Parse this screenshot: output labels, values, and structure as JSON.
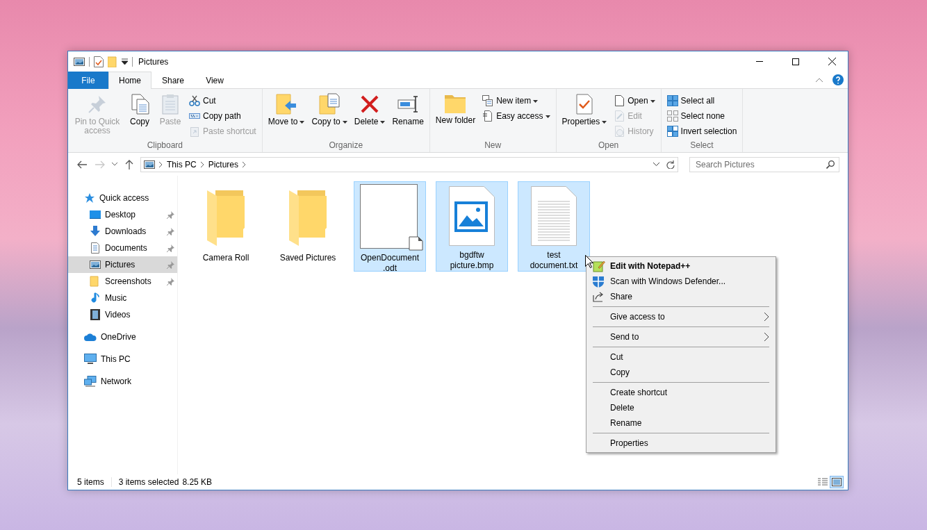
{
  "window": {
    "title": "Pictures"
  },
  "ribbon": {
    "tabs": [
      {
        "label": "File",
        "kind": "file",
        "selected": false
      },
      {
        "label": "Home",
        "kind": "tab",
        "selected": true
      },
      {
        "label": "Share",
        "kind": "tab",
        "selected": false
      },
      {
        "label": "View",
        "kind": "tab",
        "selected": false
      }
    ],
    "groups": [
      {
        "label": "Clipboard",
        "items": [
          {
            "kind": "large",
            "label": "Pin to Quick access",
            "disabled": true,
            "dropdown": false
          },
          {
            "kind": "large",
            "label": "Copy",
            "disabled": false,
            "dropdown": false
          },
          {
            "kind": "large",
            "label": "Paste",
            "disabled": true,
            "dropdown": false
          },
          {
            "kind": "stack",
            "items": [
              {
                "label": "Cut",
                "disabled": false,
                "dropdown": false
              },
              {
                "label": "Copy path",
                "disabled": false,
                "dropdown": false
              },
              {
                "label": "Paste shortcut",
                "disabled": true,
                "dropdown": false
              }
            ]
          }
        ]
      },
      {
        "label": "Organize",
        "items": [
          {
            "kind": "large",
            "label": "Move to",
            "disabled": false,
            "dropdown": true
          },
          {
            "kind": "large",
            "label": "Copy to",
            "disabled": false,
            "dropdown": true
          },
          {
            "kind": "large",
            "label": "Delete",
            "disabled": false,
            "dropdown": true
          },
          {
            "kind": "large",
            "label": "Rename",
            "disabled": false,
            "dropdown": false
          }
        ]
      },
      {
        "label": "New",
        "items": [
          {
            "kind": "large",
            "label": "New folder",
            "disabled": false,
            "dropdown": false
          },
          {
            "kind": "stack",
            "items": [
              {
                "label": "New item",
                "disabled": false,
                "dropdown": true
              },
              {
                "label": "Easy access",
                "disabled": false,
                "dropdown": true
              }
            ]
          }
        ]
      },
      {
        "label": "Open",
        "items": [
          {
            "kind": "large",
            "label": "Properties",
            "disabled": false,
            "dropdown": true
          },
          {
            "kind": "stack",
            "items": [
              {
                "label": "Open",
                "disabled": false,
                "dropdown": true
              },
              {
                "label": "Edit",
                "disabled": true,
                "dropdown": false
              },
              {
                "label": "History",
                "disabled": true,
                "dropdown": false
              }
            ]
          }
        ]
      },
      {
        "label": "Select",
        "items": [
          {
            "kind": "stack",
            "items": [
              {
                "label": "Select all",
                "disabled": false,
                "dropdown": false
              },
              {
                "label": "Select none",
                "disabled": false,
                "dropdown": false
              },
              {
                "label": "Invert selection",
                "disabled": false,
                "dropdown": false
              }
            ]
          }
        ]
      }
    ]
  },
  "address_bar": {
    "back_disabled": false,
    "forward_disabled": true,
    "breadcrumb": [
      "This PC",
      "Pictures"
    ]
  },
  "search": {
    "placeholder": "Search Pictures"
  },
  "navigation": [
    {
      "label": "Quick access",
      "selected": false,
      "pinned": false,
      "children": [
        {
          "label": "Desktop",
          "selected": false,
          "pinned": true
        },
        {
          "label": "Downloads",
          "selected": false,
          "pinned": true
        },
        {
          "label": "Documents",
          "selected": false,
          "pinned": true
        },
        {
          "label": "Pictures",
          "selected": true,
          "pinned": true
        },
        {
          "label": "Screenshots",
          "selected": false,
          "pinned": true
        },
        {
          "label": "Music",
          "selected": false,
          "pinned": false
        },
        {
          "label": "Videos",
          "selected": false,
          "pinned": false
        }
      ]
    },
    {
      "label": "OneDrive",
      "selected": false,
      "pinned": false
    },
    {
      "label": "This PC",
      "selected": false,
      "pinned": false
    },
    {
      "label": "Network",
      "selected": false,
      "pinned": false
    }
  ],
  "files": [
    {
      "name": "Camera Roll",
      "kind": "folder",
      "selected": false
    },
    {
      "name": "Saved Pictures",
      "kind": "folder",
      "selected": false
    },
    {
      "name": "OpenDocument.odt",
      "kind": "document",
      "selected": true
    },
    {
      "name": "bgdftw picture.bmp",
      "kind": "image",
      "selected": true
    },
    {
      "name": "test document.txt",
      "kind": "text",
      "selected": true
    }
  ],
  "status_bar": {
    "item_count": "5 items",
    "selection": "3 items selected",
    "size": "8.25 KB",
    "view_modes": [
      {
        "selected": false
      },
      {
        "selected": true
      }
    ]
  },
  "context_menu": [
    {
      "kind": "item",
      "label": "Edit with Notepad++",
      "default": true,
      "submenu": false
    },
    {
      "kind": "item",
      "label": "Scan with Windows Defender...",
      "default": false,
      "submenu": false
    },
    {
      "kind": "item",
      "label": "Share",
      "default": false,
      "submenu": false
    },
    {
      "kind": "separator"
    },
    {
      "kind": "item",
      "label": "Give access to",
      "default": false,
      "submenu": true
    },
    {
      "kind": "separator"
    },
    {
      "kind": "item",
      "label": "Send to",
      "default": false,
      "submenu": true
    },
    {
      "kind": "separator"
    },
    {
      "kind": "item",
      "label": "Cut",
      "default": false,
      "submenu": false
    },
    {
      "kind": "item",
      "label": "Copy",
      "default": false,
      "submenu": false
    },
    {
      "kind": "separator"
    },
    {
      "kind": "item",
      "label": "Create shortcut",
      "default": false,
      "submenu": false
    },
    {
      "kind": "item",
      "label": "Delete",
      "default": false,
      "submenu": false
    },
    {
      "kind": "item",
      "label": "Rename",
      "default": false,
      "submenu": false
    },
    {
      "kind": "separator"
    },
    {
      "kind": "item",
      "label": "Properties",
      "default": false,
      "submenu": false
    }
  ]
}
